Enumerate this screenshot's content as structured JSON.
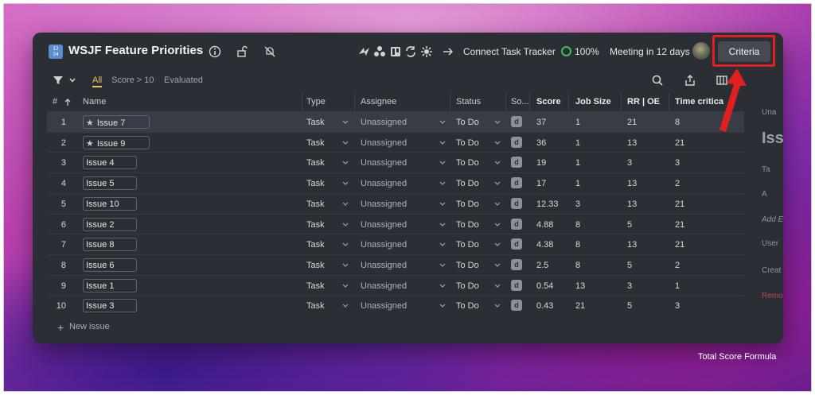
{
  "window": {
    "title": "WSJF Feature Priorities",
    "app_icon_text": [
      "12",
      "34"
    ],
    "connect_label": "Connect Task Tracker",
    "progress": "100%",
    "meeting": "Meeting in 12 days",
    "criteria_label": "Criteria"
  },
  "toolbar": {
    "views": [
      "All",
      "Score > 10",
      "Evaluated"
    ]
  },
  "table": {
    "headers": {
      "num": "#",
      "name": "Name",
      "type": "Type",
      "assignee": "Assignee",
      "status": "Status",
      "source": "So...",
      "score": "Score",
      "job_size": "Job Size",
      "rr_oe": "RR | OE",
      "time_crit": "Time critica"
    },
    "rows": [
      {
        "n": "1",
        "name": "Issue 7",
        "starred": true,
        "type": "Task",
        "assignee": "Unassigned",
        "status": "To Do",
        "src": "d",
        "score": "37",
        "job": "1",
        "rr": "21",
        "tc": "8"
      },
      {
        "n": "2",
        "name": "Issue 9",
        "starred": true,
        "type": "Task",
        "assignee": "Unassigned",
        "status": "To Do",
        "src": "d",
        "score": "36",
        "job": "1",
        "rr": "13",
        "tc": "21"
      },
      {
        "n": "3",
        "name": "Issue 4",
        "starred": false,
        "type": "Task",
        "assignee": "Unassigned",
        "status": "To Do",
        "src": "d",
        "score": "19",
        "job": "1",
        "rr": "3",
        "tc": "3"
      },
      {
        "n": "4",
        "name": "Issue 5",
        "starred": false,
        "type": "Task",
        "assignee": "Unassigned",
        "status": "To Do",
        "src": "d",
        "score": "17",
        "job": "1",
        "rr": "13",
        "tc": "2"
      },
      {
        "n": "5",
        "name": "Issue 10",
        "starred": false,
        "type": "Task",
        "assignee": "Unassigned",
        "status": "To Do",
        "src": "d",
        "score": "12.33",
        "job": "3",
        "rr": "13",
        "tc": "21"
      },
      {
        "n": "6",
        "name": "Issue 2",
        "starred": false,
        "type": "Task",
        "assignee": "Unassigned",
        "status": "To Do",
        "src": "d",
        "score": "4.88",
        "job": "8",
        "rr": "5",
        "tc": "21"
      },
      {
        "n": "7",
        "name": "Issue 8",
        "starred": false,
        "type": "Task",
        "assignee": "Unassigned",
        "status": "To Do",
        "src": "d",
        "score": "4.38",
        "job": "8",
        "rr": "13",
        "tc": "21"
      },
      {
        "n": "8",
        "name": "Issue 6",
        "starred": false,
        "type": "Task",
        "assignee": "Unassigned",
        "status": "To Do",
        "src": "d",
        "score": "2.5",
        "job": "8",
        "rr": "5",
        "tc": "2"
      },
      {
        "n": "9",
        "name": "Issue 1",
        "starred": false,
        "type": "Task",
        "assignee": "Unassigned",
        "status": "To Do",
        "src": "d",
        "score": "0.54",
        "job": "13",
        "rr": "3",
        "tc": "1"
      },
      {
        "n": "10",
        "name": "Issue 3",
        "starred": false,
        "type": "Task",
        "assignee": "Unassigned",
        "status": "To Do",
        "src": "d",
        "score": "0.43",
        "job": "21",
        "rr": "5",
        "tc": "3"
      }
    ]
  },
  "new_issue_label": "New issue",
  "side_panel": [
    "Una",
    "Iss",
    "Ta",
    "A",
    "Add E",
    "User",
    "Creat",
    "Remo"
  ],
  "caption": "Total Score Formula",
  "colors": {
    "accent_view": "#f0c35a",
    "progress_ring": "#3dbd5b",
    "highlight": "#e02020"
  }
}
